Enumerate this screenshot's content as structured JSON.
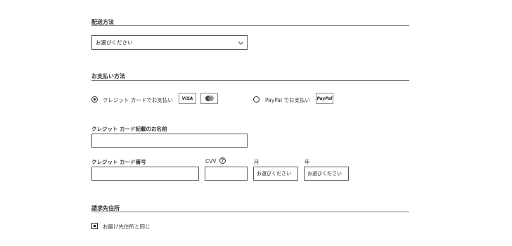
{
  "shipping": {
    "title": "配送方法",
    "select_value": "お選びください"
  },
  "payment": {
    "title": "お支払い方法",
    "credit_option": "クレジット カードでお支払い",
    "credit_selected": true,
    "visa_label": "VISA",
    "paypal_option": "PayPal でお支払い",
    "paypal_badge": "PayPal"
  },
  "card_form": {
    "name_label": "クレジット カード記載のお名前",
    "number_label": "クレジット カード番号",
    "cvv_label": "CVV",
    "cvv_help": "?",
    "month_label": "月",
    "month_value": "お選びください",
    "year_label": "年",
    "year_value": "お選びください"
  },
  "billing": {
    "title": "請求先住所",
    "same_as_shipping": "お届け先住所と同じ",
    "same_checked": true
  }
}
